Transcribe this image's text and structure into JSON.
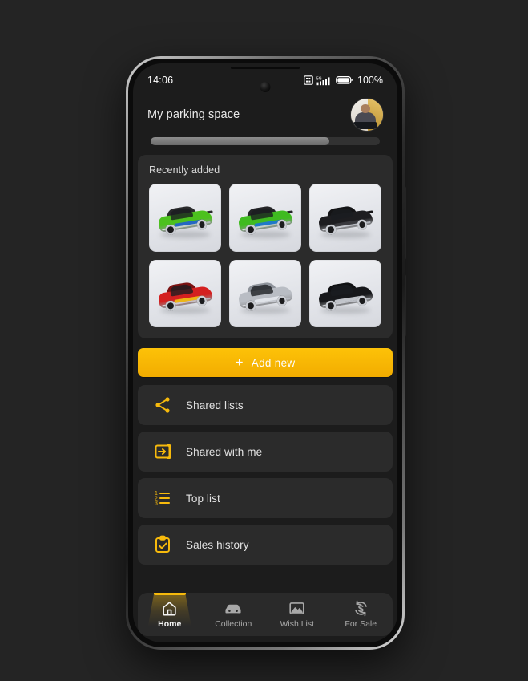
{
  "status_bar": {
    "time": "14:06",
    "network_label": "5G",
    "battery_percent": "100%",
    "icons": [
      "sim-card-icon",
      "signal-bars-icon",
      "battery-icon"
    ]
  },
  "header": {
    "title": "My parking space",
    "avatar_name": "user-avatar"
  },
  "progress": {
    "value_percent": 78
  },
  "recently_added": {
    "section_title": "Recently added",
    "cars": [
      {
        "name": "green-sports-car-1",
        "body_color": "#4cc11e",
        "cabin_color": "#2a2a2c",
        "accent_color": "#1f5fd0",
        "has_spoiler": true
      },
      {
        "name": "green-sports-car-2",
        "body_color": "#3fbb20",
        "cabin_color": "#242427",
        "accent_color": "#1a73d6",
        "has_spoiler": true
      },
      {
        "name": "black-pickup-truck",
        "body_color": "#1d1d20",
        "cabin_color": "#141416",
        "accent_color": "#3a3a3e",
        "has_spoiler": true
      },
      {
        "name": "red-flame-sports-car",
        "body_color": "#d42020",
        "cabin_color": "#7c1212",
        "accent_color": "#f2c211",
        "has_spoiler": false
      },
      {
        "name": "silver-convertible",
        "body_color": "#b9bdc4",
        "cabin_color": "#8e939b",
        "accent_color": "#e6e9ee",
        "has_spoiler": false
      },
      {
        "name": "black-classic-sedan",
        "body_color": "#17181b",
        "cabin_color": "#101113",
        "accent_color": "#cfd3d9",
        "has_spoiler": false
      }
    ]
  },
  "add_new_button": {
    "label": "Add new",
    "plus_glyph": "+",
    "color": "#f5b400"
  },
  "menu": {
    "items": [
      {
        "label": "Shared lists",
        "icon": "share-nodes-icon"
      },
      {
        "label": "Shared with me",
        "icon": "arrow-into-box-icon"
      },
      {
        "label": "Top list",
        "icon": "numbered-list-icon"
      },
      {
        "label": "Sales history",
        "icon": "clipboard-check-icon"
      }
    ]
  },
  "bottom_nav": {
    "accent_color": "#f7ba0c",
    "items": [
      {
        "label": "Home",
        "icon": "home-icon",
        "active": true
      },
      {
        "label": "Collection",
        "icon": "car-icon",
        "active": false
      },
      {
        "label": "Wish List",
        "icon": "image-icon",
        "active": false
      },
      {
        "label": "For Sale",
        "icon": "dollar-sync-icon",
        "active": false
      }
    ]
  }
}
